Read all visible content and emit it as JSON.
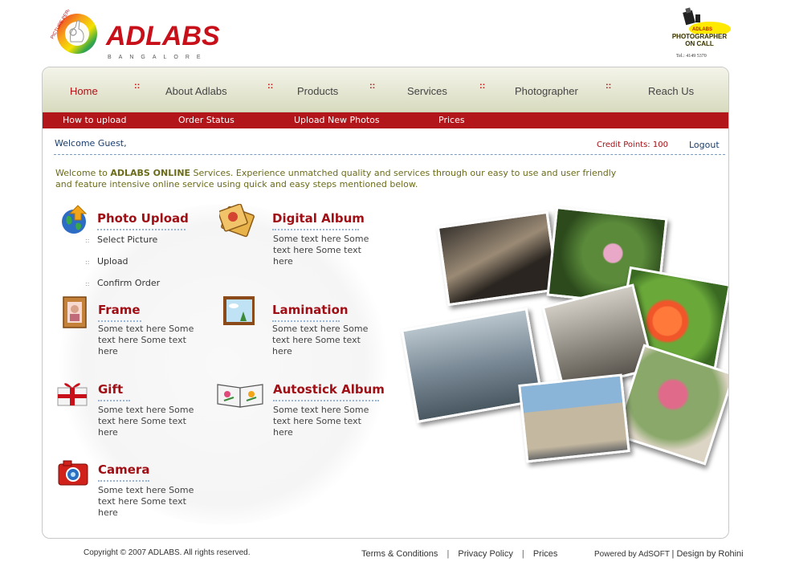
{
  "header": {
    "badge_text": "PICTURE PERFECT!",
    "brand": "ADLABS",
    "city": "BANGALORE",
    "poc_brand": "ADLABS",
    "poc_title_line1": "PHOTOGRAPHER",
    "poc_title_line2": "ON CALL",
    "poc_tel": "Tel.: 4149 5370"
  },
  "nav": {
    "items": [
      "Home",
      "About Adlabs",
      "Products",
      "Services",
      "Photographer",
      "Reach Us"
    ],
    "separator": "::"
  },
  "subnav": {
    "items": [
      "How to upload",
      "Order Status",
      "Upload New Photos",
      "Prices"
    ]
  },
  "user": {
    "welcome": "Welcome Guest,",
    "credit": "Credit Points: 100",
    "logout": "Logout"
  },
  "intro": {
    "prefix": "Welcome to ",
    "brand": "ADLABS ONLINE",
    "line1_rest": " Services. Experience unmatched quality and services through our easy to use and user friendly",
    "line2": "and feature intensive online service using quick and easy steps mentioned below."
  },
  "services": {
    "photo_upload": {
      "title": "Photo Upload",
      "steps": [
        "Select Picture",
        "Upload",
        "Confirm Order"
      ]
    },
    "digital_album": {
      "title": "Digital Album",
      "desc": "Some text here Some text here Some text here"
    },
    "frame": {
      "title": "Frame",
      "desc": "Some text here Some text here Some text here"
    },
    "lamination": {
      "title": "Lamination",
      "desc": "Some text here Some text here Some text here"
    },
    "gift": {
      "title": "Gift",
      "desc": "Some text here Some text here Some text here"
    },
    "autostick": {
      "title": "Autostick Album",
      "desc": "Some text here Some text here Some text here"
    },
    "camera": {
      "title": "Camera",
      "desc": "Some text here Some text here Some text here"
    }
  },
  "footer": {
    "copyright": "Copyright © 2007 ADLABS. All rights reserved.",
    "links": [
      "Terms & Conditions",
      "Privacy Policy",
      "Prices"
    ],
    "link_sep": "|",
    "powered": "Powered by AdSOFT",
    "design": "| Design by Rohini"
  },
  "colors": {
    "brand_red": "#c8101a",
    "subnav_bg": "#b2161a",
    "title_red": "#a00f15",
    "intro_olive": "#6b6b1a",
    "link_blue": "#1a3d6e"
  }
}
